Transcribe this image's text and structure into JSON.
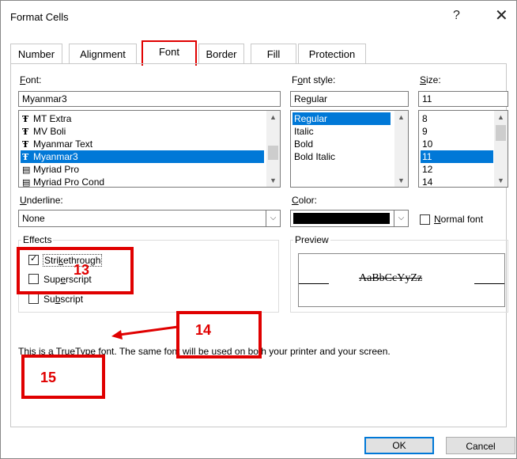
{
  "window": {
    "title": "Format Cells",
    "help": "?",
    "close": "✕"
  },
  "tabs": [
    "Number",
    "Alignment",
    "Font",
    "Border",
    "Fill",
    "Protection"
  ],
  "font": {
    "label": "Font:",
    "value": "Myanmar3",
    "list": [
      "MT Extra",
      "MV Boli",
      "Myanmar Text",
      "Myanmar3",
      "Myriad Pro",
      "Myriad Pro Cond"
    ],
    "selected": "Myanmar3"
  },
  "font_style": {
    "label": "Font style:",
    "value": "Regular",
    "list": [
      "Regular",
      "Italic",
      "Bold",
      "Bold Italic"
    ],
    "selected": "Regular"
  },
  "size": {
    "label": "Size:",
    "value": "11",
    "list": [
      "8",
      "9",
      "10",
      "11",
      "12",
      "14"
    ],
    "selected": "11"
  },
  "underline": {
    "label": "Underline:",
    "value": "None"
  },
  "color": {
    "label": "Color:",
    "swatch": "#000000"
  },
  "normal_font": {
    "label": "Normal font",
    "checked": false
  },
  "effects": {
    "legend": "Effects",
    "strikethrough": {
      "label": "Strikethrough",
      "checked": true
    },
    "superscript": {
      "label": "Superscript",
      "checked": false
    },
    "subscript": {
      "label": "Subscript",
      "checked": false
    }
  },
  "preview": {
    "legend": "Preview",
    "sample": "AaBbCcYyZz"
  },
  "info_text": "This is a TrueType font.  The same font will be used on both your printer and your screen.",
  "annotations": [
    "13",
    "14",
    "15"
  ],
  "buttons": {
    "ok": "OK",
    "cancel": "Cancel"
  },
  "colors": {
    "accent": "#0078d7",
    "annotation": "#e00000"
  },
  "icons": {
    "truetype": "truetype-font-icon",
    "printer_font": "printer-font-icon"
  }
}
